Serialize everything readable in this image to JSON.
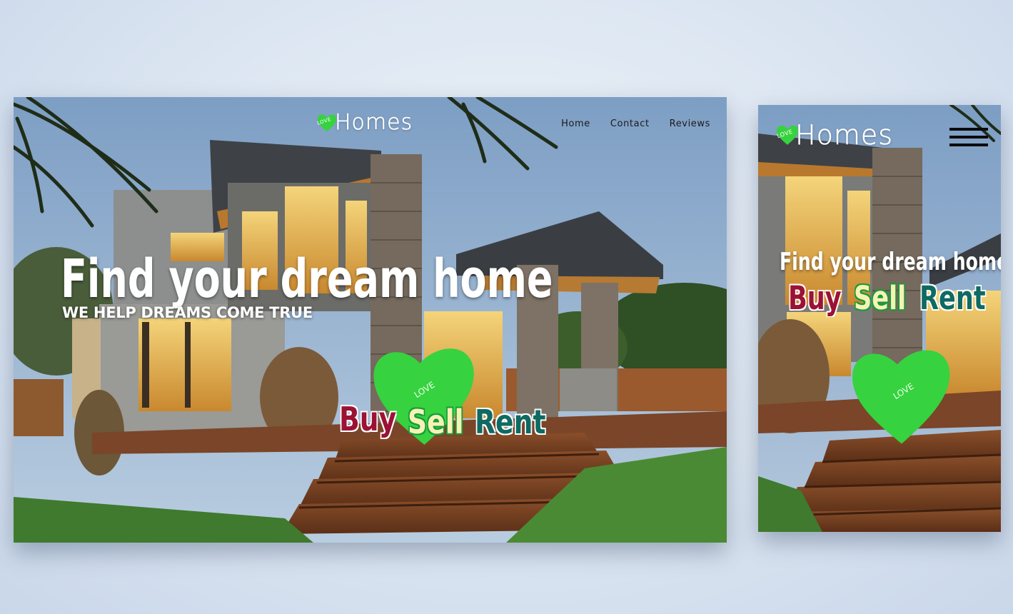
{
  "brand": {
    "mark_text": "LOVE",
    "word": "Homes",
    "accent": "#37d23f"
  },
  "nav": {
    "items": [
      "Home",
      "Contact",
      "Reviews"
    ]
  },
  "hero": {
    "title": "Find your dream home",
    "subtitle": "WE HELP DREAMS COME TRUE",
    "heart_text": "LOVE",
    "actions": [
      "Buy",
      "Sell",
      "Rent"
    ]
  },
  "mobile": {
    "title": "Find your dream home",
    "actions": [
      "Buy",
      "Sell",
      "Rent"
    ],
    "heart_text": "LOVE",
    "menu_icon": "hamburger-menu-icon"
  },
  "colors": {
    "buy": "#9b1234",
    "sell": "#f6f2b4",
    "rent": "#0e6a62",
    "heart": "#37d23f"
  }
}
